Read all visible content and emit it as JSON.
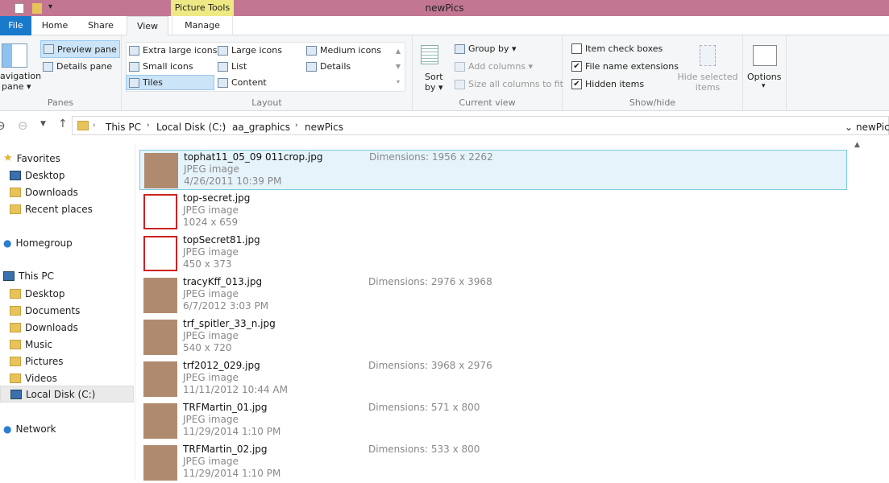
{
  "window": {
    "title": "newPics",
    "context_tab": "Picture Tools",
    "accent": "#c27692"
  },
  "tabs": [
    "File",
    "Home",
    "Share",
    "View",
    "Manage"
  ],
  "ribbon": {
    "panes": {
      "label": "Panes",
      "navigation": "avigation",
      "navigation2": "pane ▾",
      "preview": "Preview pane",
      "details": "Details pane"
    },
    "layout": {
      "label": "Layout",
      "items": [
        "Extra large icons",
        "Large icons",
        "Medium icons",
        "Small icons",
        "List",
        "Details",
        "Tiles",
        "Content"
      ],
      "selected": "Tiles"
    },
    "current_view": {
      "label": "Current view",
      "sort": "Sort",
      "sort2": "by ▾",
      "group_by": "Group by ▾",
      "add_columns": "Add columns ▾",
      "size_columns": "Size all columns to fit"
    },
    "show_hide": {
      "label": "Show/hide",
      "item_check_boxes": "Item check boxes",
      "file_name_extensions": "File name extensions",
      "hidden_items": "Hidden items",
      "hide_selected": "Hide selected",
      "hide_selected2": "items",
      "checks": {
        "item_check_boxes": false,
        "file_name_extensions": true,
        "hidden_items": true
      }
    },
    "options": {
      "label": "Options",
      "arrow": "▾"
    }
  },
  "address": {
    "crumbs": [
      "This PC",
      "Local Disk (C:)",
      "aa_graphics",
      "newPics"
    ],
    "current": "newPics"
  },
  "nav": {
    "items": [
      {
        "label": "Favorites",
        "icon": "star-icon"
      },
      {
        "label": "Desktop",
        "icon": "desktop-icon"
      },
      {
        "label": "Downloads",
        "icon": "folder-icon"
      },
      {
        "label": "Recent places",
        "icon": "recent-icon"
      },
      {
        "label": "Homegroup",
        "icon": "homegroup-icon"
      },
      {
        "label": "This PC",
        "icon": "computer-icon"
      },
      {
        "label": "Desktop",
        "icon": "folder-icon"
      },
      {
        "label": "Documents",
        "icon": "folder-icon"
      },
      {
        "label": "Downloads",
        "icon": "folder-icon"
      },
      {
        "label": "Music",
        "icon": "folder-icon"
      },
      {
        "label": "Pictures",
        "icon": "folder-icon"
      },
      {
        "label": "Videos",
        "icon": "folder-icon"
      },
      {
        "label": "Local Disk (C:)",
        "icon": "drive-icon"
      },
      {
        "label": "Network",
        "icon": "network-icon"
      }
    ]
  },
  "files": [
    {
      "name": "tophat11_05_09 011crop.jpg",
      "type": "JPEG image",
      "line3": "4/26/2011 10:39 PM",
      "dims": "Dimensions:  1956 x 2262",
      "selected": true
    },
    {
      "name": "top-secret.jpg",
      "type": "JPEG image",
      "line3": "1024 x 659",
      "dims": ""
    },
    {
      "name": "topSecret81.jpg",
      "type": "JPEG image",
      "line3": "450 x 373",
      "dims": ""
    },
    {
      "name": "tracyKff_013.jpg",
      "type": "JPEG image",
      "line3": "6/7/2012 3:03 PM",
      "dims": "Dimensions:  2976 x 3968"
    },
    {
      "name": "trf_spitler_33_n.jpg",
      "type": "JPEG image",
      "line3": "540 x 720",
      "dims": ""
    },
    {
      "name": "trf2012_029.jpg",
      "type": "JPEG image",
      "line3": "11/11/2012 10:44 AM",
      "dims": "Dimensions:  3968 x 2976"
    },
    {
      "name": "TRFMartin_01.jpg",
      "type": "JPEG image",
      "line3": "11/29/2014 1:10 PM",
      "dims": "Dimensions:  571 x 800"
    },
    {
      "name": "TRFMartin_02.jpg",
      "type": "JPEG image",
      "line3": "11/29/2014 1:10 PM",
      "dims": "Dimensions:  533 x 800"
    }
  ]
}
